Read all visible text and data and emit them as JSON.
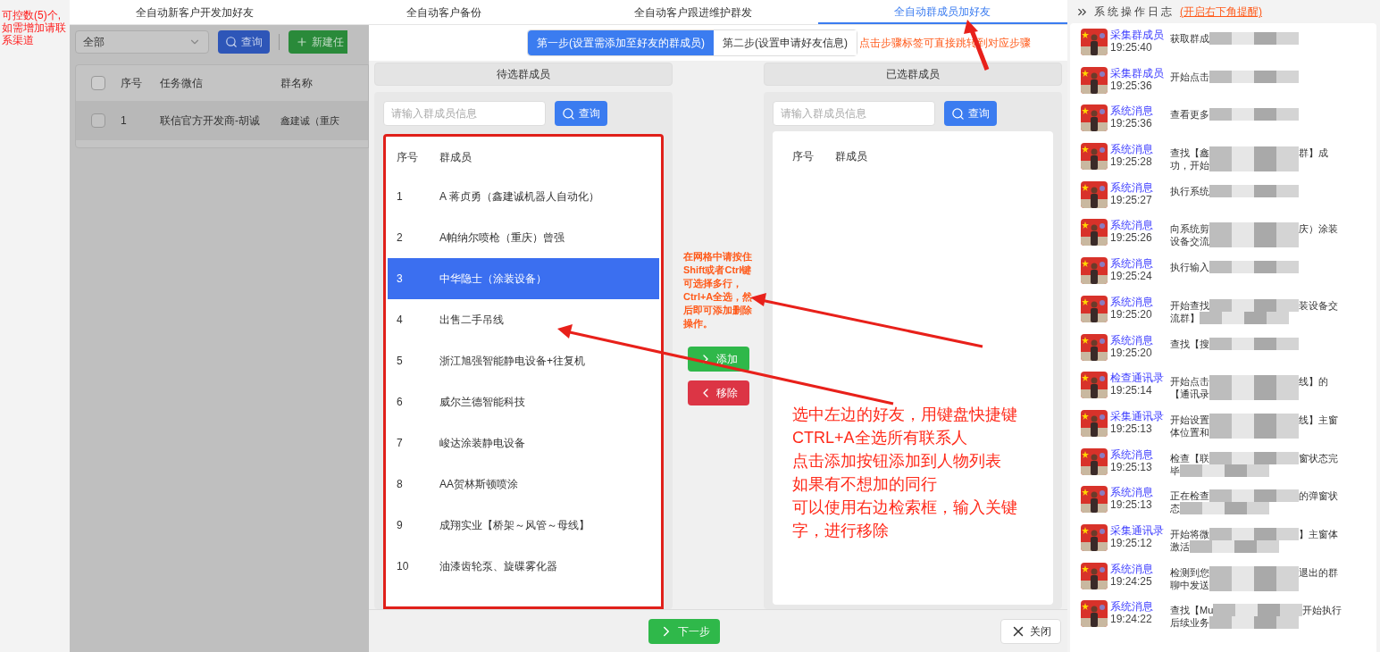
{
  "left_strip": {
    "notice": "可控数(5)个,如需增加请联系渠道"
  },
  "tabs": [
    {
      "label": "全自动新客户开发加好友",
      "selected": false
    },
    {
      "label": "全自动客户备份",
      "selected": false
    },
    {
      "label": "全自动客户跟进维护群发",
      "selected": false
    },
    {
      "label": "全自动群成员加好友",
      "selected": true
    }
  ],
  "background": {
    "all_checked": false,
    "filter_value": "全部",
    "search_button": "查询",
    "new_button": "新建任",
    "columns": [
      "序号",
      "任务微信",
      "群名称"
    ],
    "rows": [
      {
        "cells": [
          "1",
          "联信官方开发商-胡诚",
          "鑫建诚（重庆"
        ],
        "checked": false
      }
    ]
  },
  "dialog": {
    "steps": [
      {
        "label": "第一步(设置需添加至好友的群成员)",
        "selected": true
      },
      {
        "label": "第二步(设置申请好友信息)",
        "selected": false
      }
    ],
    "step_hint": "点击步骤标签可直接跳转到对应步骤",
    "left_panel": {
      "title": "待选群成员",
      "placeholder": "请输入群成员信息",
      "search_button": "查询",
      "columns": [
        "序号",
        "群成员"
      ],
      "rows": [
        {
          "index": "1",
          "name": "A 蒋贞勇（鑫建诚机器人自动化）",
          "selected": false
        },
        {
          "index": "2",
          "name": "A帕纳尔喷枪（重庆）曾强",
          "selected": false
        },
        {
          "index": "3",
          "name": "中华隐士（涂装设备）",
          "selected": true
        },
        {
          "index": "4",
          "name": "出售二手吊线",
          "selected": false
        },
        {
          "index": "5",
          "name": "浙江旭强智能静电设备+往复机",
          "selected": false
        },
        {
          "index": "6",
          "name": "威尔兰德智能科技",
          "selected": false
        },
        {
          "index": "7",
          "name": "峻达涂装静电设备",
          "selected": false
        },
        {
          "index": "8",
          "name": "AA贺林斯顿喷涂",
          "selected": false
        },
        {
          "index": "9",
          "name": "成翔实业【桥架～风管～母线】",
          "selected": false
        },
        {
          "index": "10",
          "name": "油漆齿轮泵、旋碟雾化器",
          "selected": false
        }
      ]
    },
    "middle_note": "在网格中请按住Shift或者Ctrl键可选择多行，Ctrl+A全选，然后即可添加删除操作。",
    "add_button": "添加",
    "remove_button": "移除",
    "right_panel": {
      "title": "已选群成员",
      "placeholder": "请输入群成员信息",
      "search_button": "查询",
      "columns": [
        "序号",
        "群成员"
      ]
    },
    "next_button": "下一步",
    "close_button": "关闭"
  },
  "annotation": {
    "lines": [
      "选中左边的好友，用键盘快捷键",
      "CTRL+A全选所有联系人",
      "点击添加按钮添加到人物列表",
      "如果有不想加的同行",
      "可以使用右边检索框，输入关键",
      "字，进行移除"
    ]
  },
  "log": {
    "title": "系统操作日志",
    "toggle_link": "(开启右下角提醒)",
    "entries": [
      {
        "source": "采集群成员",
        "time": "19:25:40",
        "lines": [
          {
            "head": "获取群成"
          }
        ]
      },
      {
        "source": "采集群成员",
        "time": "19:25:36",
        "lines": [
          {
            "head": "开始点击"
          }
        ]
      },
      {
        "source": "系统消息",
        "time": "19:25:36",
        "lines": [
          {
            "head": "查看更多"
          }
        ]
      },
      {
        "source": "系统消息",
        "time": "19:25:28",
        "lines": [
          {
            "head": "查找【鑫",
            "tail": "群】成"
          },
          {
            "head": "功，开始"
          }
        ]
      },
      {
        "source": "系统消息",
        "time": "19:25:27",
        "lines": [
          {
            "head": "执行系统"
          }
        ]
      },
      {
        "source": "系统消息",
        "time": "19:25:26",
        "lines": [
          {
            "head": "向系统剪",
            "tail": "庆）涂装"
          },
          {
            "head": "设备交流"
          }
        ]
      },
      {
        "source": "系统消息",
        "time": "19:25:24",
        "lines": [
          {
            "head": "执行输入"
          }
        ]
      },
      {
        "source": "系统消息",
        "time": "19:25:20",
        "lines": [
          {
            "head": "开始查找",
            "tail": "装设备交"
          },
          {
            "head": "流群】"
          }
        ]
      },
      {
        "source": "系统消息",
        "time": "19:25:20",
        "lines": [
          {
            "head": "查找【搜"
          }
        ]
      },
      {
        "source": "检查通讯录",
        "time": "19:25:14",
        "lines": [
          {
            "head": "开始点击",
            "tail": "线】的"
          },
          {
            "head": "【通讯录"
          }
        ]
      },
      {
        "source": "采集通讯录",
        "time": "19:25:13",
        "lines": [
          {
            "head": "开始设置",
            "tail": "线】主窗"
          },
          {
            "head": "体位置和"
          }
        ]
      },
      {
        "source": "系统消息",
        "time": "19:25:13",
        "lines": [
          {
            "head": "检查【联",
            "tail": "窗状态完"
          },
          {
            "head": "毕"
          }
        ]
      },
      {
        "source": "系统消息",
        "time": "19:25:13",
        "lines": [
          {
            "head": "正在检查",
            "tail": "的弹窗状"
          },
          {
            "head": "态"
          }
        ]
      },
      {
        "source": "采集通讯录",
        "time": "19:25:12",
        "lines": [
          {
            "head": "开始将微",
            "tail": "】主窗体"
          },
          {
            "head": "激活"
          }
        ]
      },
      {
        "source": "系统消息",
        "time": "19:24:25",
        "lines": [
          {
            "head": "检测到您",
            "tail": "退出的群"
          },
          {
            "head": "聊中发送"
          }
        ]
      },
      {
        "source": "系统消息",
        "time": "19:24:22",
        "lines": [
          {
            "head": "查找【Mu",
            "tail": "开始执行"
          },
          {
            "head": "后续业务"
          }
        ]
      }
    ]
  }
}
